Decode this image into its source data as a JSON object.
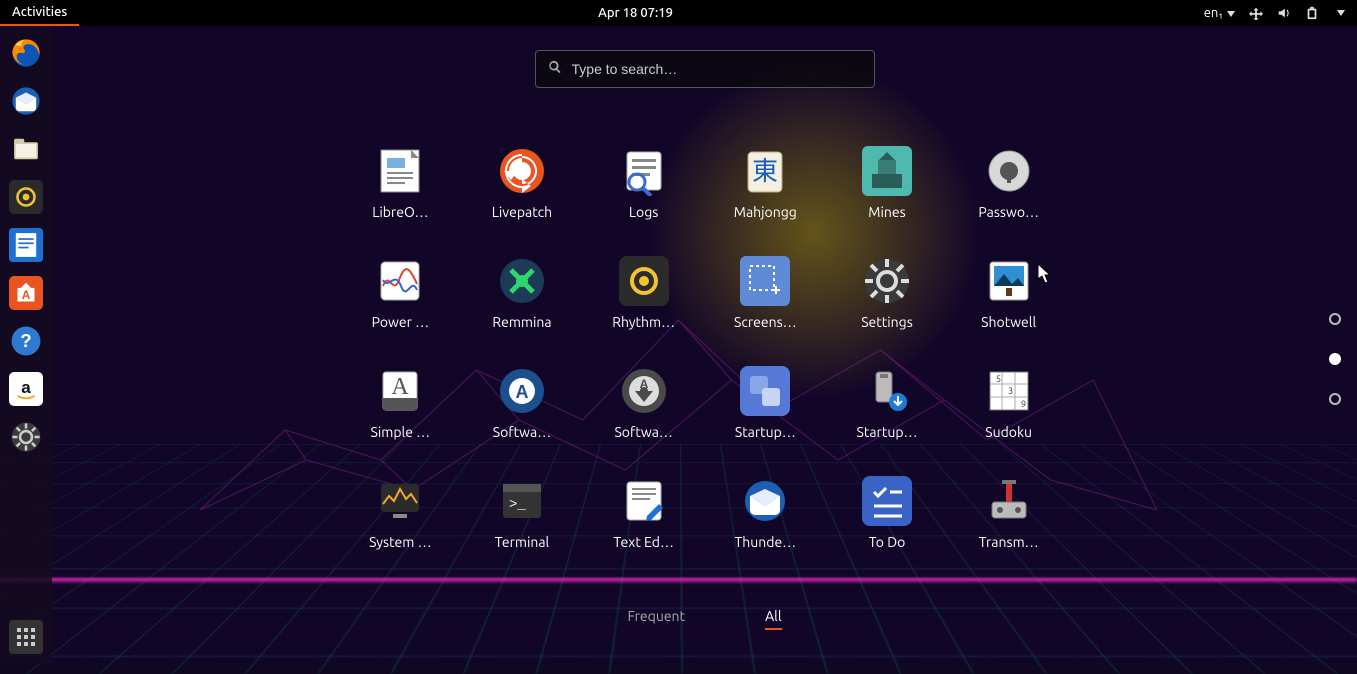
{
  "topbar": {
    "activities": "Activities",
    "clock": "Apr 18  07:19",
    "input": "en₁"
  },
  "search": {
    "placeholder": "Type to search…"
  },
  "dock": [
    {
      "name": "firefox",
      "bg": "transparent"
    },
    {
      "name": "thunderbird",
      "bg": "transparent"
    },
    {
      "name": "files",
      "bg": "#eee8dc"
    },
    {
      "name": "rhythmbox",
      "bg": "#2b2b2b"
    },
    {
      "name": "writer",
      "bg": "#1f6fd0"
    },
    {
      "name": "software",
      "bg": "#e95420"
    },
    {
      "name": "help",
      "bg": "#2f7ad1"
    },
    {
      "name": "amazon",
      "bg": "#fff"
    },
    {
      "name": "settings",
      "bg": "#3a3a3a"
    }
  ],
  "apps": [
    {
      "label": "LibreO…",
      "name": "libreoffice",
      "bg": "#fff"
    },
    {
      "label": "Livepatch",
      "name": "livepatch",
      "bg": "#e95420"
    },
    {
      "label": "Logs",
      "name": "logs",
      "bg": "#fff"
    },
    {
      "label": "Mahjongg",
      "name": "mahjongg",
      "bg": "#f4efe0"
    },
    {
      "label": "Mines",
      "name": "mines",
      "bg": "#4fb9b0"
    },
    {
      "label": "Passwo…",
      "name": "passwords",
      "bg": "#d8d8d8"
    },
    {
      "label": "Power …",
      "name": "power-stats",
      "bg": "#fff"
    },
    {
      "label": "Remmina",
      "name": "remmina",
      "bg": "#1b3b57"
    },
    {
      "label": "Rhythm…",
      "name": "rhythmbox-app",
      "bg": "#2b2b2b"
    },
    {
      "label": "Screens…",
      "name": "screenshot",
      "bg": "#5f8bd6"
    },
    {
      "label": "Settings",
      "name": "settings-app",
      "bg": "#3a3a3a"
    },
    {
      "label": "Shotwell",
      "name": "shotwell",
      "bg": "#fff"
    },
    {
      "label": "Simple …",
      "name": "simple-scan",
      "bg": "#fff"
    },
    {
      "label": "Softwa…",
      "name": "software-center",
      "bg": "#1c4f8e"
    },
    {
      "label": "Softwa…",
      "name": "software-updater",
      "bg": "#4a4a4a"
    },
    {
      "label": "Startup…",
      "name": "startup-apps",
      "bg": "#5679d8"
    },
    {
      "label": "Startup…",
      "name": "startup-disk",
      "bg": "#ccc"
    },
    {
      "label": "Sudoku",
      "name": "sudoku",
      "bg": "#fff"
    },
    {
      "label": "System …",
      "name": "system-monitor",
      "bg": "#2b2b2b"
    },
    {
      "label": "Terminal",
      "name": "terminal",
      "bg": "#333"
    },
    {
      "label": "Text Ed…",
      "name": "text-editor",
      "bg": "#fff"
    },
    {
      "label": "Thunde…",
      "name": "thunderbird-app",
      "bg": "transparent"
    },
    {
      "label": "To Do",
      "name": "todo",
      "bg": "#3a63c6"
    },
    {
      "label": "Transm…",
      "name": "transmission",
      "bg": "#ddd"
    }
  ],
  "tabs": {
    "frequent": "Frequent",
    "all": "All",
    "active": "all"
  },
  "pager": {
    "total": 3,
    "active": 1
  }
}
